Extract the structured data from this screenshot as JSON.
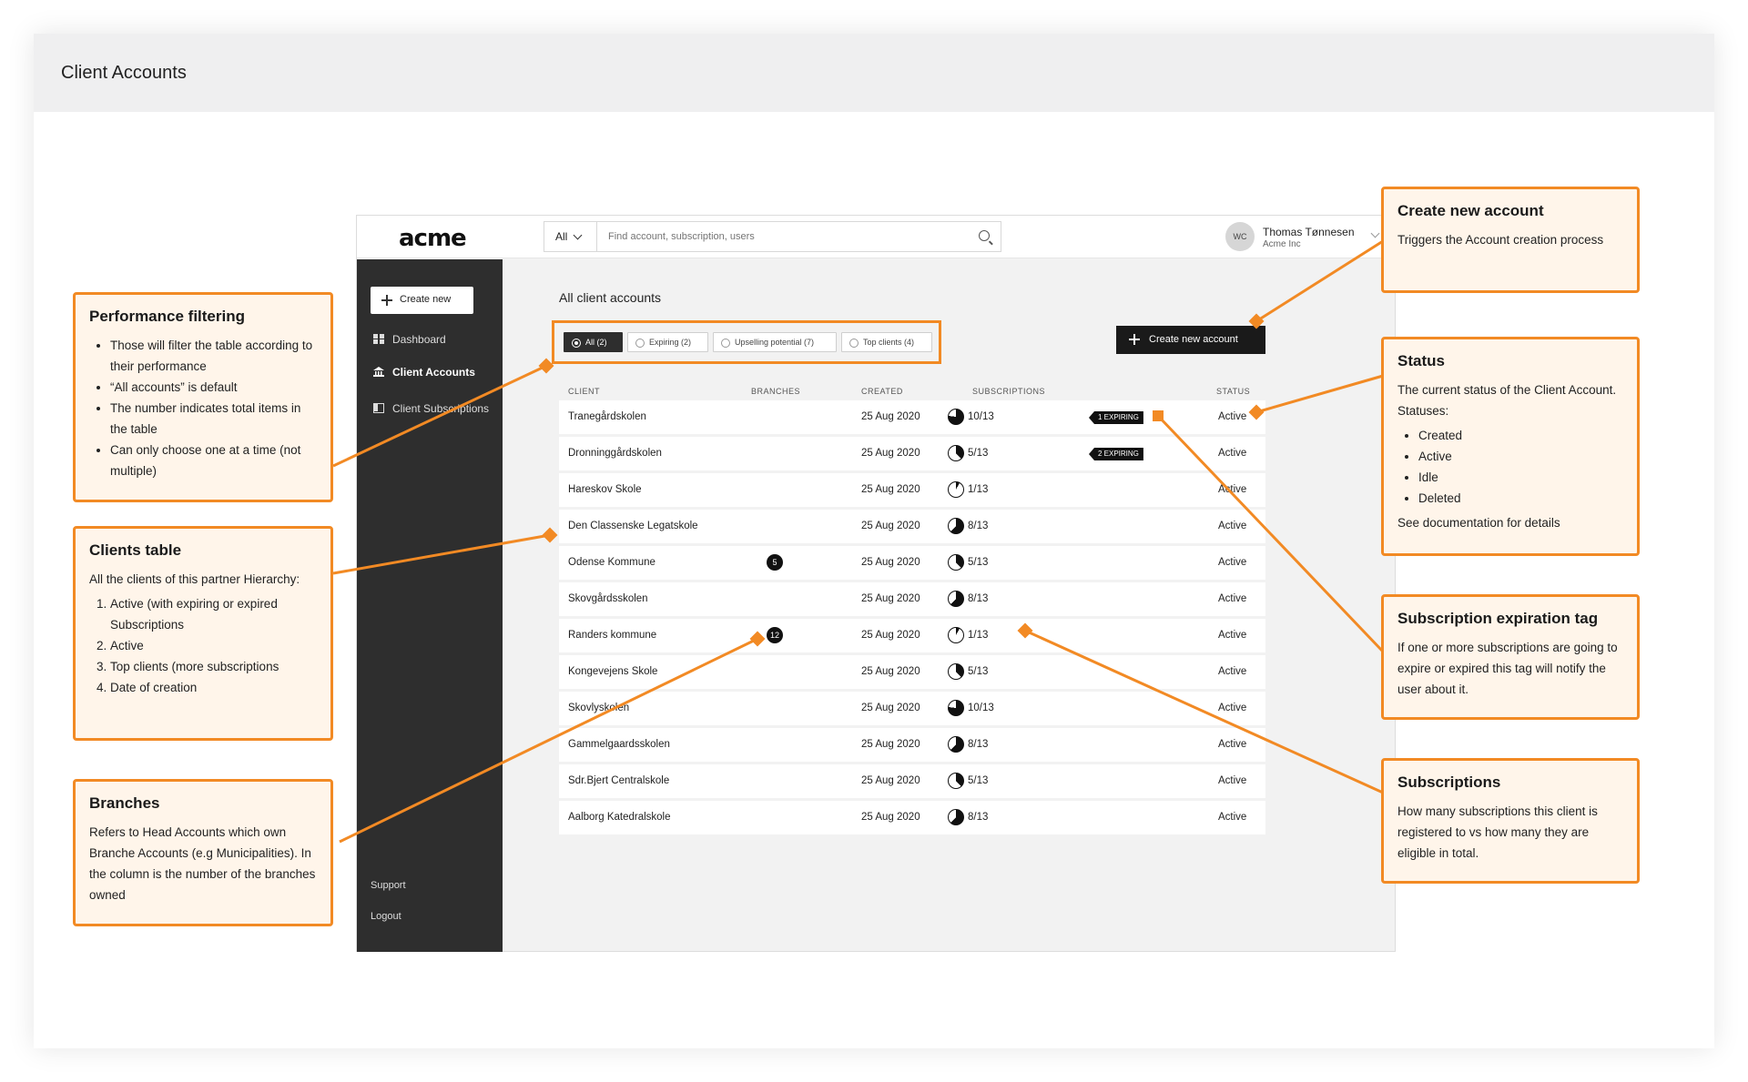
{
  "page": {
    "title": "Client Accounts"
  },
  "app": {
    "logo": "acme",
    "search": {
      "scope": "All",
      "placeholder": "Find account, subscription, users"
    },
    "user": {
      "initials": "WC",
      "name": "Thomas Tønnesen",
      "org": "Acme Inc"
    },
    "sidebar": {
      "create_label": "Create new",
      "items": [
        {
          "label": "Dashboard",
          "icon": "dashboard-icon"
        },
        {
          "label": "Client Accounts",
          "icon": "bank-icon"
        },
        {
          "label": "Client Subscriptions",
          "icon": "book-icon"
        }
      ],
      "bottom": [
        {
          "label": "Support"
        },
        {
          "label": "Logout"
        }
      ]
    },
    "content_title": "All client accounts",
    "filters": [
      {
        "label": "All (2)",
        "active": true
      },
      {
        "label": "Expiring (2)",
        "active": false
      },
      {
        "label": "Upselling potential (7)",
        "active": false
      },
      {
        "label": "Top clients (4)",
        "active": false
      }
    ],
    "new_account_label": "Create new account",
    "table": {
      "headers": [
        "CLIENT",
        "BRANCHES",
        "CREATED",
        "SUBSCRIPTIONS",
        "STATUS"
      ],
      "rows": [
        {
          "client": "Tranegårdskolen",
          "branches": "",
          "created": "25 Aug 2020",
          "subs": "10/13",
          "fraction": 0.77,
          "tag": "1 EXPIRING",
          "status": "Active"
        },
        {
          "client": "Dronninggårdskolen",
          "branches": "",
          "created": "25 Aug 2020",
          "subs": "5/13",
          "fraction": 0.38,
          "tag": "2 EXPIRING",
          "status": "Active"
        },
        {
          "client": "Hareskov Skole",
          "branches": "",
          "created": "25 Aug 2020",
          "subs": "1/13",
          "fraction": 0.08,
          "tag": "",
          "status": "Active"
        },
        {
          "client": "Den Classenske Legatskole",
          "branches": "",
          "created": "25 Aug 2020",
          "subs": "8/13",
          "fraction": 0.62,
          "tag": "",
          "status": "Active"
        },
        {
          "client": "Odense Kommune",
          "branches": "5",
          "created": "25 Aug 2020",
          "subs": "5/13",
          "fraction": 0.38,
          "tag": "",
          "status": "Active"
        },
        {
          "client": "Skovgårdsskolen",
          "branches": "",
          "created": "25 Aug 2020",
          "subs": "8/13",
          "fraction": 0.62,
          "tag": "",
          "status": "Active"
        },
        {
          "client": "Randers kommune",
          "branches": "12",
          "created": "25 Aug 2020",
          "subs": "1/13",
          "fraction": 0.08,
          "tag": "",
          "status": "Active"
        },
        {
          "client": "Kongevejens Skole",
          "branches": "",
          "created": "25 Aug 2020",
          "subs": "5/13",
          "fraction": 0.38,
          "tag": "",
          "status": "Active"
        },
        {
          "client": "Skovlyskolen",
          "branches": "",
          "created": "25 Aug 2020",
          "subs": "10/13",
          "fraction": 0.77,
          "tag": "",
          "status": "Active"
        },
        {
          "client": "Gammelgaardsskolen",
          "branches": "",
          "created": "25 Aug 2020",
          "subs": "8/13",
          "fraction": 0.62,
          "tag": "",
          "status": "Active"
        },
        {
          "client": "Sdr.Bjert Centralskole",
          "branches": "",
          "created": "25 Aug 2020",
          "subs": "5/13",
          "fraction": 0.38,
          "tag": "",
          "status": "Active"
        },
        {
          "client": "Aalborg Katedralskole",
          "branches": "",
          "created": "25 Aug 2020",
          "subs": "8/13",
          "fraction": 0.62,
          "tag": "",
          "status": "Active"
        }
      ]
    }
  },
  "callouts": {
    "performance": {
      "title": "Performance filtering",
      "items": [
        "Those will filter the table according to their performance",
        "“All accounts” is default",
        "The number indicates total items in the table",
        "Can only choose one at a time (not multiple)"
      ]
    },
    "clients_table": {
      "title": "Clients table",
      "intro": "All the clients of this partner Hierarchy:",
      "items": [
        "Active (with expiring or expired Subscriptions",
        "Active",
        "Top clients (more subscriptions",
        "Date of creation"
      ]
    },
    "branches": {
      "title": "Branches",
      "text": "Refers to Head Accounts which own Branche Accounts (e.g Municipalities). In the column is the number of the branches owned"
    },
    "create_account": {
      "title": "Create new account",
      "text": "Triggers the Account creation process"
    },
    "status": {
      "title": "Status",
      "intro": "The current status of the Client Account. Statuses:",
      "items": [
        "Created",
        "Active",
        "Idle",
        "Deleted"
      ],
      "footer": "See documentation for details"
    },
    "expiration": {
      "title": "Subscription expiration tag",
      "text": "If one or more subscriptions are going to expire or expired this tag will notify the user about it."
    },
    "subscriptions": {
      "title": "Subscriptions",
      "text": "How many subscriptions this client is registered to vs how many they are eligible in total."
    }
  },
  "colors": {
    "accent": "#f28a24",
    "callout_bg": "#fff5ea",
    "sidebar": "#2e2e2e"
  }
}
